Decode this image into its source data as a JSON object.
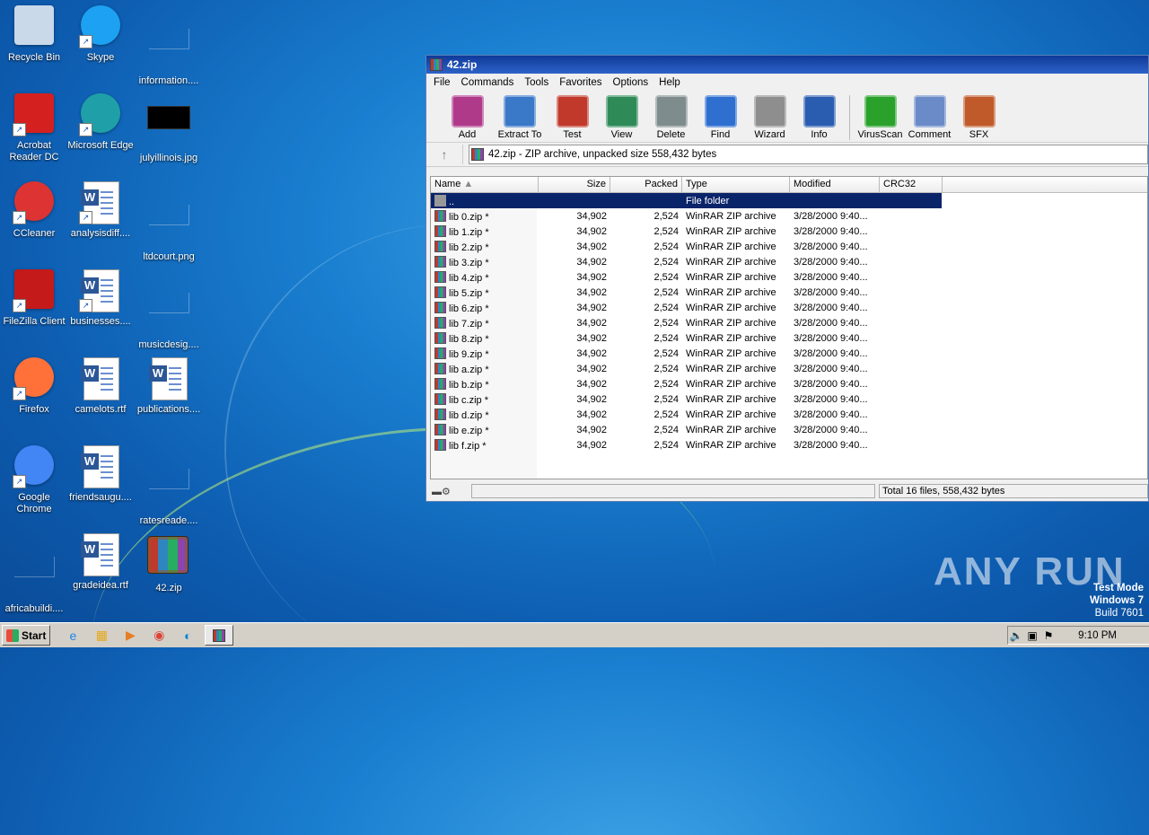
{
  "desktop": {
    "icons": [
      {
        "label": "Recycle Bin",
        "icon": "recycle-bin-icon"
      },
      {
        "label": "Skype",
        "icon": "skype-icon"
      },
      {
        "label": "information....",
        "icon": "file-icon"
      },
      {
        "label": "Acrobat Reader DC",
        "icon": "acrobat-icon"
      },
      {
        "label": "Microsoft Edge",
        "icon": "edge-icon"
      },
      {
        "label": "julyillinois.jpg",
        "icon": "image-file-icon"
      },
      {
        "label": "CCleaner",
        "icon": "ccleaner-icon"
      },
      {
        "label": "analysisdiff....",
        "icon": "word-doc-icon"
      },
      {
        "label": "ltdcourt.png",
        "icon": "image-file-icon"
      },
      {
        "label": "FileZilla Client",
        "icon": "filezilla-icon"
      },
      {
        "label": "businesses....",
        "icon": "word-doc-icon"
      },
      {
        "label": "musicdesig....",
        "icon": "file-icon"
      },
      {
        "label": "Firefox",
        "icon": "firefox-icon"
      },
      {
        "label": "camelots.rtf",
        "icon": "word-doc-icon"
      },
      {
        "label": "publications....",
        "icon": "word-doc-icon"
      },
      {
        "label": "Google Chrome",
        "icon": "chrome-icon"
      },
      {
        "label": "friendsaugu....",
        "icon": "word-doc-icon"
      },
      {
        "label": "ratesreade....",
        "icon": "file-icon"
      },
      {
        "label": "africabuildi....",
        "icon": "file-icon"
      },
      {
        "label": "gradeidea.rtf",
        "icon": "word-doc-icon"
      },
      {
        "label": "42.zip",
        "icon": "winrar-archive-icon"
      }
    ]
  },
  "window": {
    "title": "42.zip",
    "menu": [
      "File",
      "Commands",
      "Tools",
      "Favorites",
      "Options",
      "Help"
    ],
    "toolbar": [
      {
        "label": "Add",
        "icon": "add-icon"
      },
      {
        "label": "Extract To",
        "icon": "extract-icon"
      },
      {
        "label": "Test",
        "icon": "test-icon"
      },
      {
        "label": "View",
        "icon": "view-icon"
      },
      {
        "label": "Delete",
        "icon": "delete-icon"
      },
      {
        "label": "Find",
        "icon": "find-icon"
      },
      {
        "label": "Wizard",
        "icon": "wizard-icon"
      },
      {
        "label": "Info",
        "icon": "info-icon"
      },
      {
        "label": "VirusScan",
        "icon": "virusscan-icon"
      },
      {
        "label": "Comment",
        "icon": "comment-icon"
      },
      {
        "label": "SFX",
        "icon": "sfx-icon"
      }
    ],
    "address": "42.zip - ZIP archive, unpacked size 558,432 bytes",
    "columns": [
      "Name",
      "Size",
      "Packed",
      "Type",
      "Modified",
      "CRC32"
    ],
    "parent_row": {
      "name": "..",
      "type": "File folder"
    },
    "files": [
      {
        "name": "lib 0.zip *",
        "size": "34,902",
        "packed": "2,524",
        "type": "WinRAR ZIP archive",
        "modified": "3/28/2000 9:40..."
      },
      {
        "name": "lib 1.zip *",
        "size": "34,902",
        "packed": "2,524",
        "type": "WinRAR ZIP archive",
        "modified": "3/28/2000 9:40..."
      },
      {
        "name": "lib 2.zip *",
        "size": "34,902",
        "packed": "2,524",
        "type": "WinRAR ZIP archive",
        "modified": "3/28/2000 9:40..."
      },
      {
        "name": "lib 3.zip *",
        "size": "34,902",
        "packed": "2,524",
        "type": "WinRAR ZIP archive",
        "modified": "3/28/2000 9:40..."
      },
      {
        "name": "lib 4.zip *",
        "size": "34,902",
        "packed": "2,524",
        "type": "WinRAR ZIP archive",
        "modified": "3/28/2000 9:40..."
      },
      {
        "name": "lib 5.zip *",
        "size": "34,902",
        "packed": "2,524",
        "type": "WinRAR ZIP archive",
        "modified": "3/28/2000 9:40..."
      },
      {
        "name": "lib 6.zip *",
        "size": "34,902",
        "packed": "2,524",
        "type": "WinRAR ZIP archive",
        "modified": "3/28/2000 9:40..."
      },
      {
        "name": "lib 7.zip *",
        "size": "34,902",
        "packed": "2,524",
        "type": "WinRAR ZIP archive",
        "modified": "3/28/2000 9:40..."
      },
      {
        "name": "lib 8.zip *",
        "size": "34,902",
        "packed": "2,524",
        "type": "WinRAR ZIP archive",
        "modified": "3/28/2000 9:40..."
      },
      {
        "name": "lib 9.zip *",
        "size": "34,902",
        "packed": "2,524",
        "type": "WinRAR ZIP archive",
        "modified": "3/28/2000 9:40..."
      },
      {
        "name": "lib a.zip *",
        "size": "34,902",
        "packed": "2,524",
        "type": "WinRAR ZIP archive",
        "modified": "3/28/2000 9:40..."
      },
      {
        "name": "lib b.zip *",
        "size": "34,902",
        "packed": "2,524",
        "type": "WinRAR ZIP archive",
        "modified": "3/28/2000 9:40..."
      },
      {
        "name": "lib c.zip *",
        "size": "34,902",
        "packed": "2,524",
        "type": "WinRAR ZIP archive",
        "modified": "3/28/2000 9:40..."
      },
      {
        "name": "lib d.zip *",
        "size": "34,902",
        "packed": "2,524",
        "type": "WinRAR ZIP archive",
        "modified": "3/28/2000 9:40..."
      },
      {
        "name": "lib e.zip *",
        "size": "34,902",
        "packed": "2,524",
        "type": "WinRAR ZIP archive",
        "modified": "3/28/2000 9:40..."
      },
      {
        "name": "lib f.zip *",
        "size": "34,902",
        "packed": "2,524",
        "type": "WinRAR ZIP archive",
        "modified": "3/28/2000 9:40..."
      }
    ],
    "status": "Total 16 files, 558,432 bytes"
  },
  "watermark": {
    "brand": "ANY RUN",
    "line1": "Test Mode",
    "line2": "Windows 7",
    "line3": "Build 7601"
  },
  "taskbar": {
    "start_label": "Start",
    "quick_launch": [
      "ie-icon",
      "explorer-icon",
      "media-player-icon",
      "chrome-icon",
      "edge-icon"
    ],
    "active_app": "winrar-icon",
    "clock": "9:10 PM"
  }
}
